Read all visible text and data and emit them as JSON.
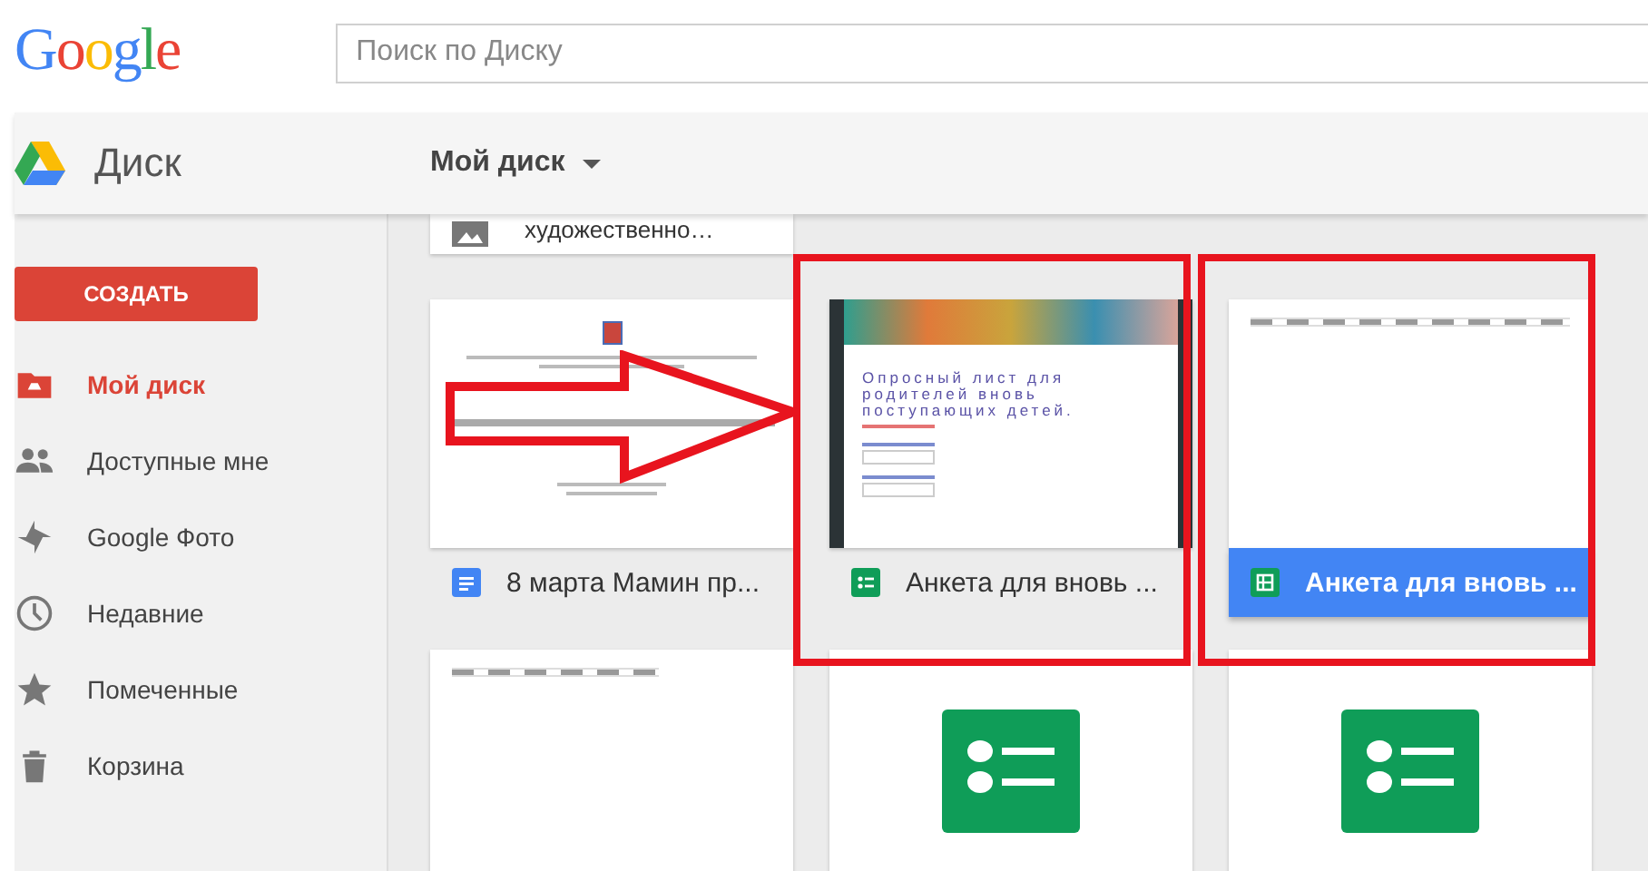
{
  "header": {
    "logo": "Google",
    "search": {
      "placeholder": "Поиск по Диску"
    }
  },
  "app_bar": {
    "app_name": "Диск",
    "location": "Мой диск"
  },
  "sidebar": {
    "create_button": "СОЗДАТЬ",
    "items": [
      {
        "label": "Мой диск",
        "selected": true
      },
      {
        "label": "Доступные мне",
        "selected": false
      },
      {
        "label": "Google Фото",
        "selected": false
      },
      {
        "label": "Недавние",
        "selected": false
      },
      {
        "label": "Помеченные",
        "selected": false
      },
      {
        "label": "Корзина",
        "selected": false
      }
    ]
  },
  "partial_file": {
    "name": "художественно…"
  },
  "files": [
    {
      "name": "8 марта Мамин пр...",
      "kind": "doc",
      "selected": false
    },
    {
      "name": "Анкета для вновь ...",
      "kind": "form",
      "preview_title": "Опросный лист для родителей вновь поступающих детей.",
      "selected": false
    },
    {
      "name": "Анкета для вновь ...",
      "kind": "sheet",
      "selected": true
    },
    {
      "kind": "sheet"
    },
    {
      "kind": "form"
    },
    {
      "kind": "form"
    }
  ]
}
